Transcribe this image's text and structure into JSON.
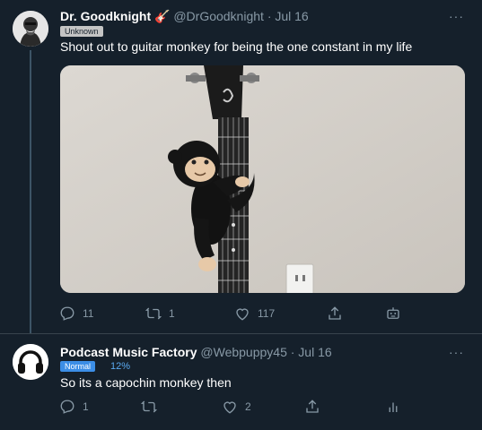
{
  "tweet1": {
    "name": "Dr. Goodknight",
    "name_emoji": "🎸",
    "handle": "@DrGoodknight",
    "date": "· Jul 16",
    "badge": "Unknown",
    "text": "Shout out to guitar monkey for being the one constant in my life",
    "more": "···",
    "media_icon": "photo-guitar-monkey",
    "actions": {
      "replies": "11",
      "retweets": "1",
      "likes": "117"
    }
  },
  "tweet2": {
    "name": "Podcast Music Factory",
    "handle": "@Webpuppy45",
    "date": "· Jul 16",
    "badge": "Normal",
    "percent": "12%",
    "text": "So its a capochin monkey then",
    "more": "···",
    "actions": {
      "replies": "1",
      "retweets": "",
      "likes": "2"
    }
  },
  "icons": {
    "reply": "reply-icon",
    "retweet": "retweet-icon",
    "like": "heart-icon",
    "share": "share-icon",
    "bot": "robot-icon",
    "analytics": "analytics-icon"
  },
  "colors": {
    "background": "#15202b",
    "muted": "#8899a6",
    "divider": "#38444d",
    "accent": "#3c8ee6"
  }
}
